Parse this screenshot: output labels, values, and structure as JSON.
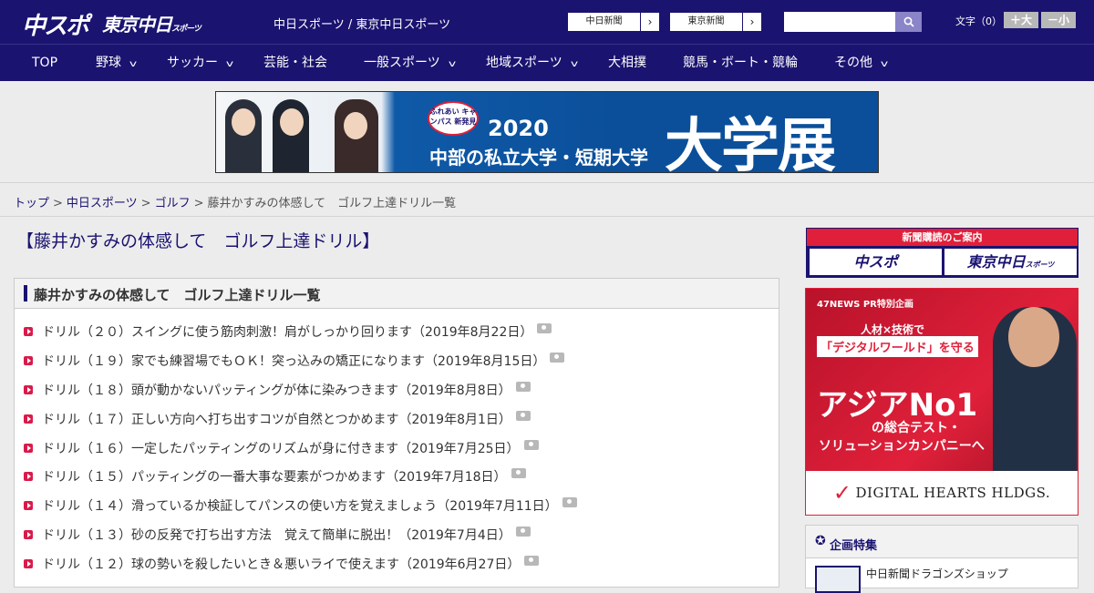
{
  "header": {
    "logo_main": "中スポ",
    "logo_tokyo": "東京中日",
    "logo_tokyo_small": "スポーツ",
    "site_name": "中日スポーツ / 東京中日スポーツ",
    "paper_links": [
      {
        "label": "中日新聞",
        "arrow": "›"
      },
      {
        "label": "東京新聞",
        "arrow": "›"
      }
    ],
    "search": {
      "value": "",
      "placeholder": ""
    },
    "font_size": {
      "label": "文字（0）",
      "bigger": "＋大",
      "smaller": "－小"
    }
  },
  "nav": {
    "items": [
      {
        "label": "TOP",
        "has_dropdown": false
      },
      {
        "label": "野球",
        "has_dropdown": true
      },
      {
        "label": "サッカー",
        "has_dropdown": true
      },
      {
        "label": "芸能・社会",
        "has_dropdown": false
      },
      {
        "label": "一般スポーツ",
        "has_dropdown": true
      },
      {
        "label": "地域スポーツ",
        "has_dropdown": true
      },
      {
        "label": "大相撲",
        "has_dropdown": false
      },
      {
        "label": "競馬・ボート・競輪",
        "has_dropdown": false
      },
      {
        "label": "その他",
        "has_dropdown": true
      }
    ]
  },
  "banner": {
    "badge": "ふれあい キャンパス 新発見",
    "year": "2020",
    "subtitle": "中部の私立大学・短期大学",
    "headline": "大学展"
  },
  "breadcrumb": {
    "items": [
      "トップ",
      "中日スポーツ",
      "ゴルフ"
    ],
    "current": "藤井かすみの体感して　ゴルフ上達ドリル一覧",
    "separator": ">"
  },
  "page": {
    "title": "【藤井かすみの体感して　ゴルフ上達ドリル】",
    "list_heading": "藤井かすみの体感して　ゴルフ上達ドリル一覧"
  },
  "articles": [
    {
      "title": "ドリル（２０）スイングに使う筋肉刺激！肩がしっかり回ります（2019年8月22日）",
      "has_photo": true
    },
    {
      "title": "ドリル（１９）家でも練習場でもＯＫ！突っ込みの矯正になります（2019年8月15日）",
      "has_photo": true
    },
    {
      "title": "ドリル（１８）頭が動かないパッティングが体に染みつきます（2019年8月8日）",
      "has_photo": true
    },
    {
      "title": "ドリル（１７）正しい方向へ打ち出すコツが自然とつかめます（2019年8月1日）",
      "has_photo": true
    },
    {
      "title": "ドリル（１６）一定したパッティングのリズムが身に付きます（2019年7月25日）",
      "has_photo": true
    },
    {
      "title": "ドリル（１５）パッティングの一番大事な要素がつかめます（2019年7月18日）",
      "has_photo": true
    },
    {
      "title": "ドリル（１４）滑っているか検証してパンスの使い方を覚えましょう（2019年7月11日）",
      "has_photo": true
    },
    {
      "title": "ドリル（１３）砂の反発で打ち出す方法　覚えて簡単に脱出！（2019年7月4日）",
      "has_photo": true
    },
    {
      "title": "ドリル（１２）球の勢いを殺したいとき＆悪いライで使えます（2019年6月27日）",
      "has_photo": true
    }
  ],
  "sidebar": {
    "subscribe": {
      "heading": "新聞購読のご案内",
      "option_1": "中スポ",
      "option_2": "東京中日",
      "option_2_small": "スポーツ"
    },
    "ad": {
      "pr": "47NEWS PR特別企画",
      "line1": "人材×技術で",
      "line2": "「デジタルワールド」を守る",
      "line3": "アジアNo1",
      "line4": "の総合テスト・",
      "line5": "ソリューションカンパニーへ",
      "sponsor": "DIGITAL HEARTS HLDGS."
    },
    "features": {
      "heading": "企画特集",
      "first_item": "中日新聞ドラゴンズショップ"
    }
  },
  "colors": {
    "brand_navy": "#1a1370",
    "accent_red": "#e0203a",
    "list_marker": "#d91a4a"
  }
}
